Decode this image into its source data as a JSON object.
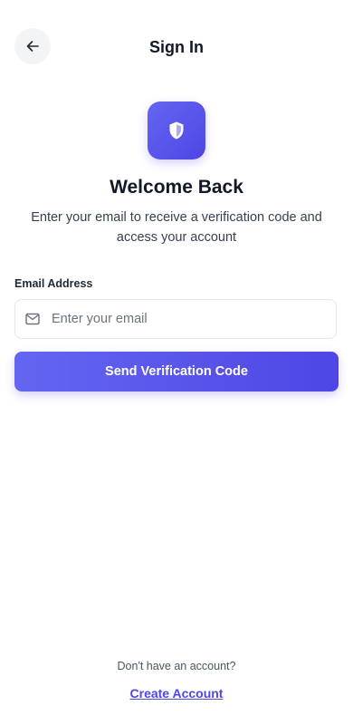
{
  "header": {
    "title": "Sign In",
    "back_icon": "arrow-left-icon"
  },
  "hero": {
    "icon": "shield-icon",
    "title": "Welcome Back",
    "subtitle": "Enter your email to receive a verification code and access your account"
  },
  "form": {
    "email_label": "Email Address",
    "email_icon": "mail-icon",
    "email_placeholder": "Enter your email",
    "email_value": "",
    "submit_label": "Send Verification Code"
  },
  "footer": {
    "prompt": "Don't have an account?",
    "link_label": "Create Account"
  },
  "colors": {
    "accent": "#4f46e5",
    "accent_light": "#6366f1",
    "text_primary": "#111827",
    "text_secondary": "#374151",
    "border": "#e5e7eb",
    "back_button_bg": "#f3f4f6"
  }
}
